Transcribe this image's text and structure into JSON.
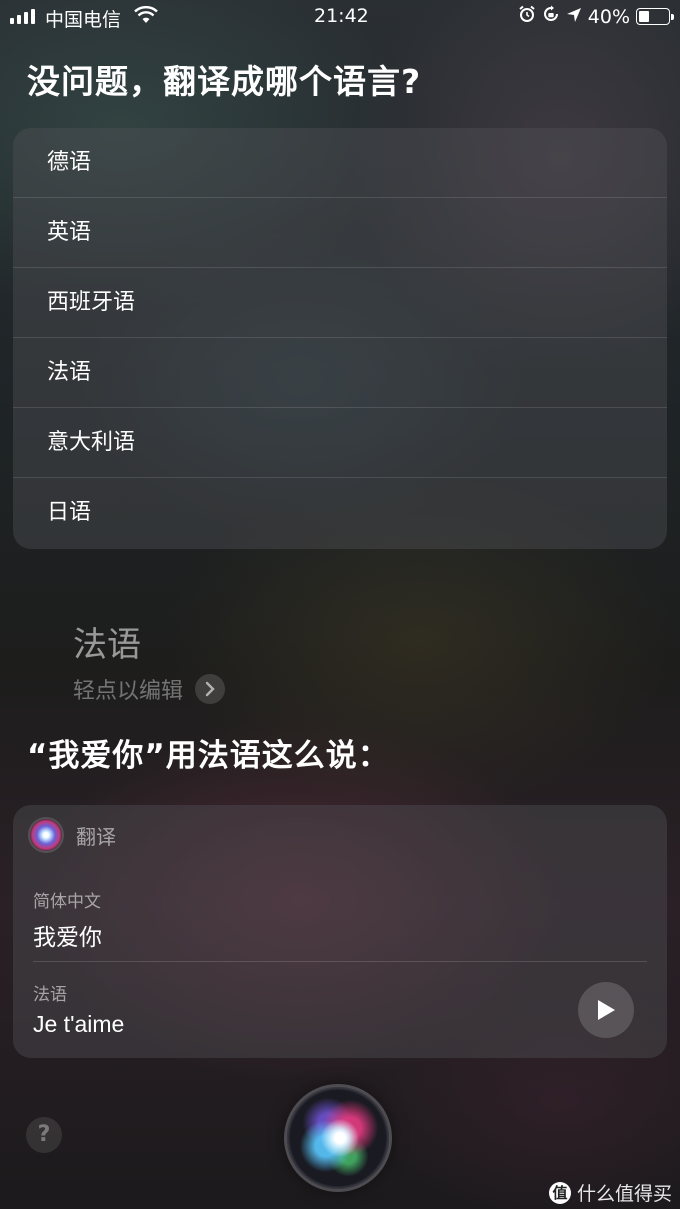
{
  "status_bar": {
    "carrier": "中国电信",
    "time": "21:42",
    "battery": "40%",
    "battery_level": 0.4,
    "icons": [
      "signal-icon",
      "wifi-icon",
      "alarm-icon",
      "rotation-lock-icon",
      "location-icon",
      "battery-icon"
    ]
  },
  "siri": {
    "question": "没问题，翻译成哪个语言?",
    "languages": [
      "德语",
      "英语",
      "西班牙语",
      "法语",
      "意大利语",
      "日语"
    ],
    "selected_language": "法语",
    "edit_hint": "轻点以编辑",
    "answer": "“我爱你”用法语这么说："
  },
  "translation_card": {
    "title": "翻译",
    "source_label": "简体中文",
    "source_text": "我爱你",
    "target_label": "法语",
    "target_text": "Je t'aime"
  },
  "bottom": {
    "help_label": "?",
    "watermark_badge": "值",
    "watermark_text": "什么值得买"
  }
}
